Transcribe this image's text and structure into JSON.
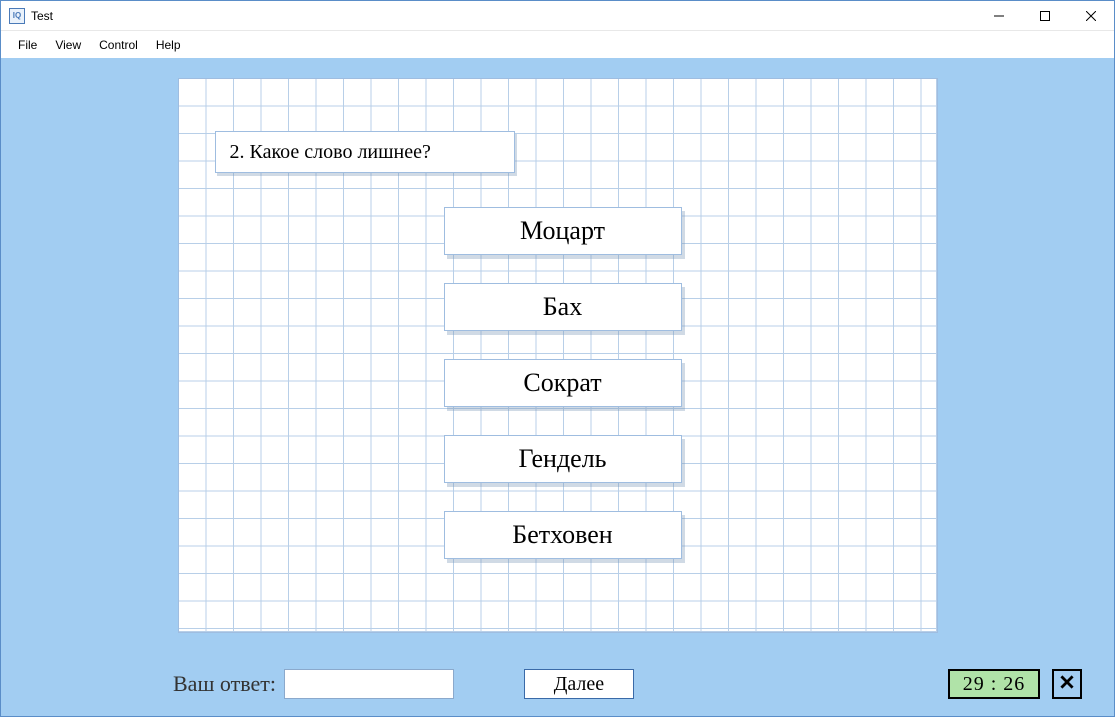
{
  "window": {
    "title": "Test",
    "icon_text": "IQ"
  },
  "menu": {
    "file": "File",
    "view": "View",
    "control": "Control",
    "help": "Help"
  },
  "question": {
    "text": "2. Какое слово  лишнее?"
  },
  "options": [
    "Моцарт",
    "Бах",
    "Сократ",
    "Гендель",
    "Бетховен"
  ],
  "footer": {
    "answer_label": "Ваш ответ:",
    "answer_value": "",
    "next_label": "Далее",
    "timer": "29 : 26"
  }
}
